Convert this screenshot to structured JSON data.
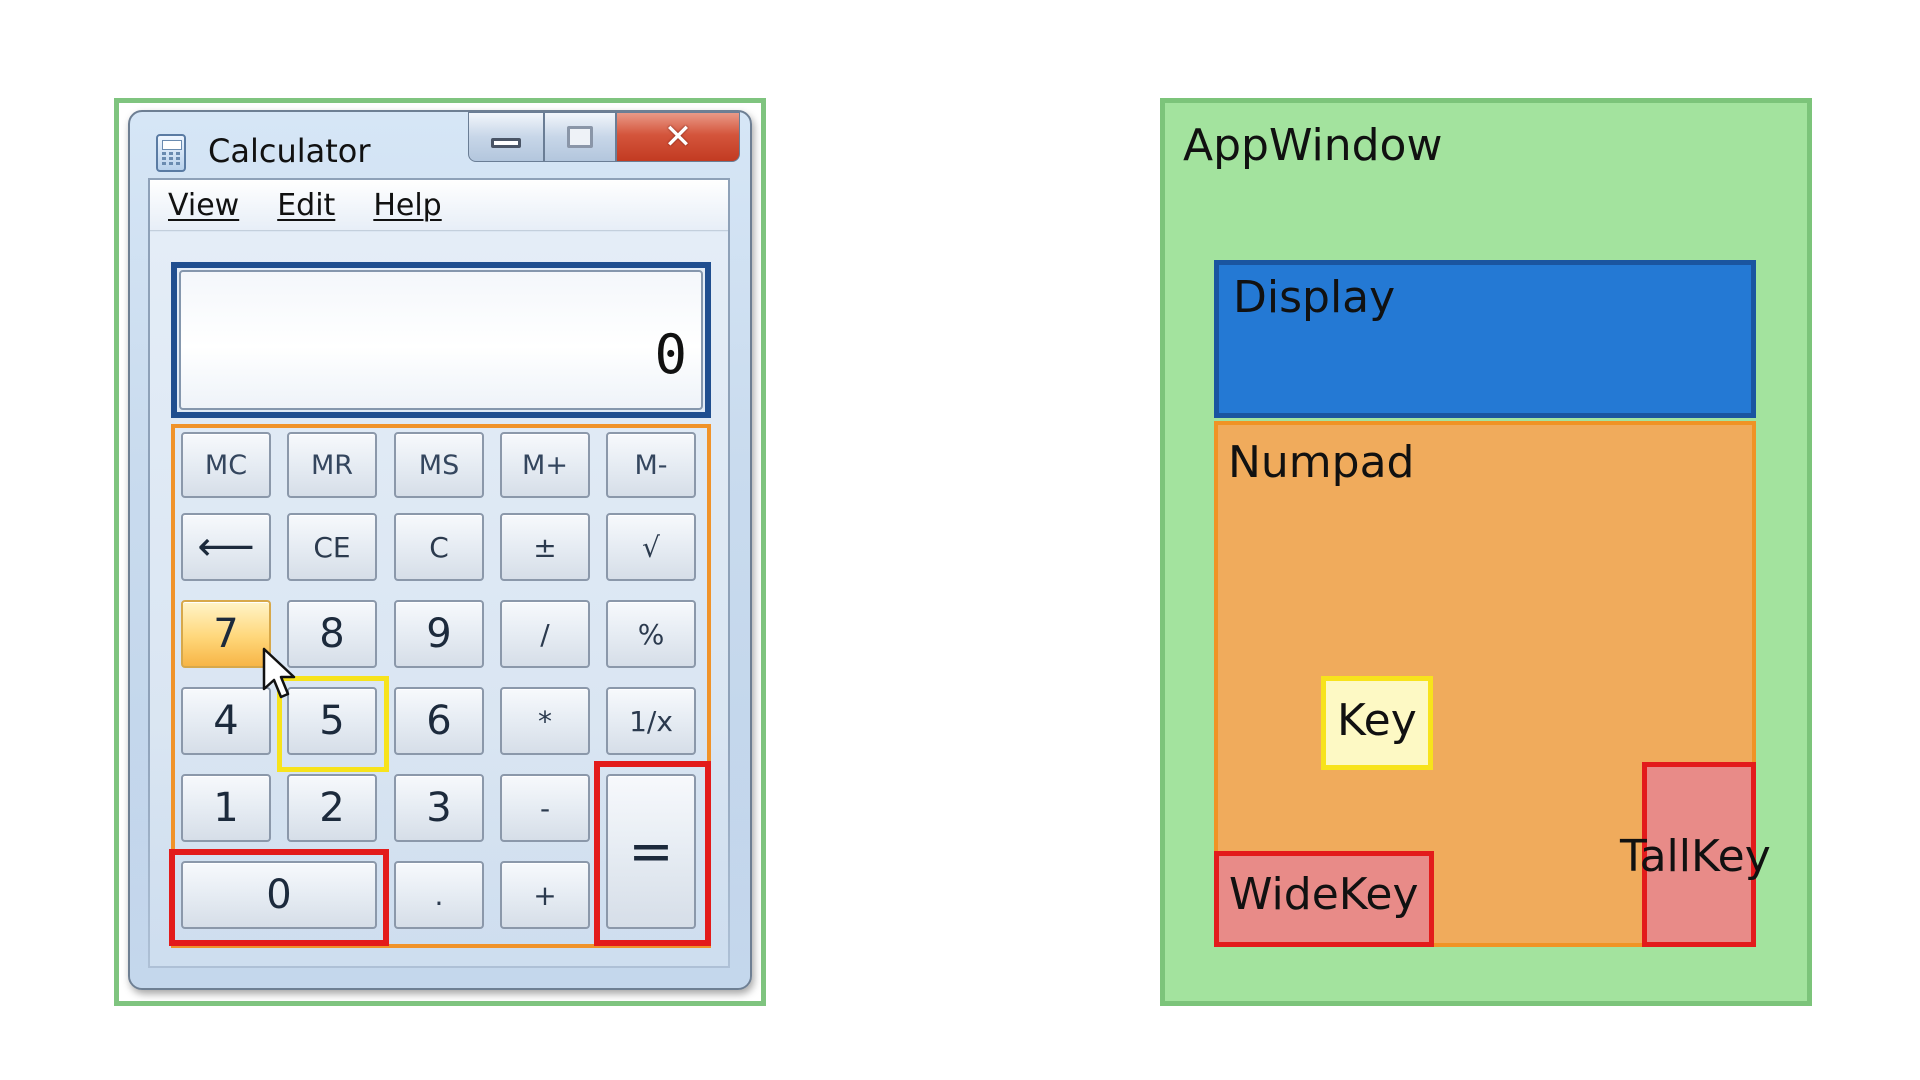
{
  "calculator": {
    "window_title": "Calculator",
    "window_icon": "calculator-icon",
    "controls": {
      "minimize_icon": "minimize-icon",
      "maximize_icon": "maximize-icon",
      "close_glyph": "✕",
      "close_icon": "close-icon"
    },
    "menu": [
      "View",
      "Edit",
      "Help"
    ],
    "display_value": "0",
    "keys": [
      {
        "label": "MC",
        "style": "mem"
      },
      {
        "label": "MR",
        "style": "mem"
      },
      {
        "label": "MS",
        "style": "mem"
      },
      {
        "label": "M+",
        "style": "mem"
      },
      {
        "label": "M-",
        "style": "mem"
      },
      {
        "label": "⟵",
        "style": ""
      },
      {
        "label": "CE",
        "style": "small"
      },
      {
        "label": "C",
        "style": "small"
      },
      {
        "label": "±",
        "style": "small"
      },
      {
        "label": "√",
        "style": "small"
      },
      {
        "label": "7",
        "style": "hot"
      },
      {
        "label": "8",
        "style": ""
      },
      {
        "label": "9",
        "style": ""
      },
      {
        "label": "/",
        "style": "small"
      },
      {
        "label": "%",
        "style": "small"
      },
      {
        "label": "4",
        "style": ""
      },
      {
        "label": "5",
        "style": ""
      },
      {
        "label": "6",
        "style": ""
      },
      {
        "label": "*",
        "style": "small"
      },
      {
        "label": "1/x",
        "style": "small"
      },
      {
        "label": "1",
        "style": ""
      },
      {
        "label": "2",
        "style": ""
      },
      {
        "label": "3",
        "style": ""
      },
      {
        "label": "-",
        "style": "small"
      },
      {
        "label": "0",
        "style": ""
      },
      {
        "label": ".",
        "style": "small"
      },
      {
        "label": "+",
        "style": "small"
      },
      {
        "label": "=",
        "style": "eq"
      }
    ],
    "cursor_icon": "mouse-pointer-icon",
    "colors": {
      "app_outline": "#7fc47f",
      "display_outline": "#1f4e8f",
      "numpad_outline": "#f0932a",
      "key_outline": "#f7e31c",
      "widekey_outline": "#e31b1b",
      "tallkey_outline": "#e31b1b"
    }
  },
  "diagram": {
    "app": "AppWindow",
    "display": "Display",
    "numpad": "Numpad",
    "key": "Key",
    "widekey": "WideKey",
    "tallkey": "TallKey",
    "colors": {
      "app": "#a3e39e",
      "display": "#2479d4",
      "numpad": "#f0ab5c",
      "key": "#fdf9c4",
      "widekey": "#e88b88",
      "tallkey": "#e88b88"
    }
  }
}
